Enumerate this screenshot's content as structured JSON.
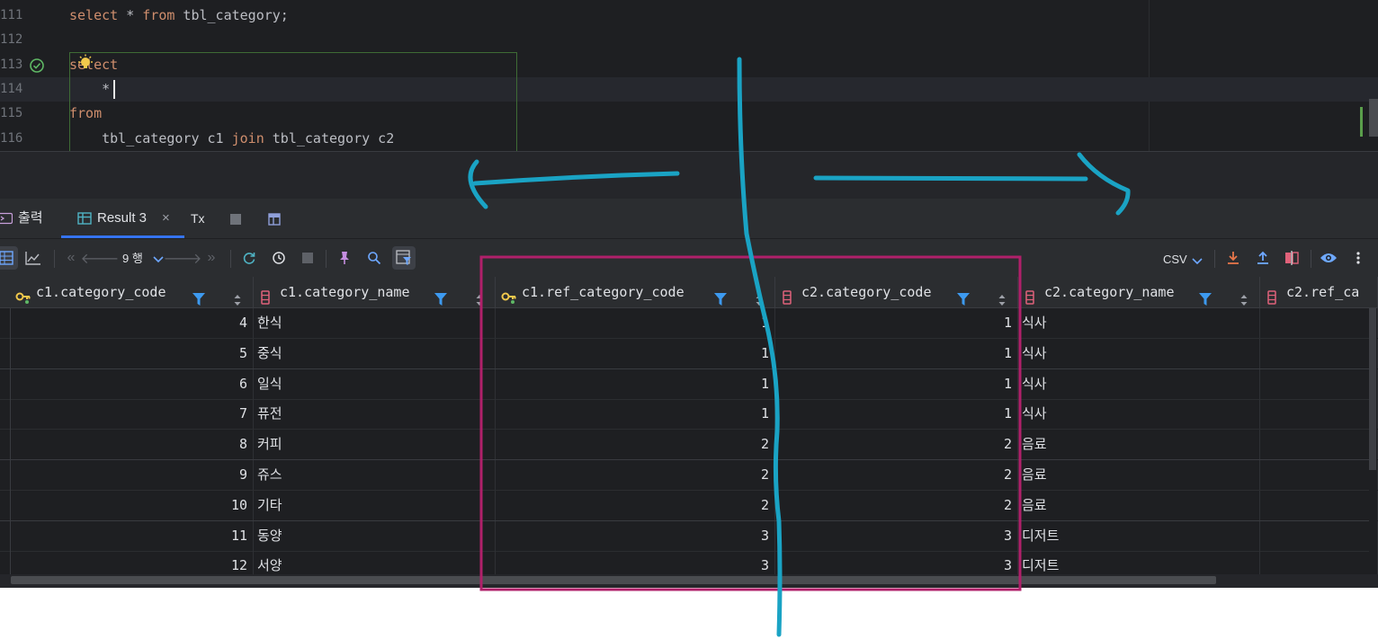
{
  "editor": {
    "lines": [
      {
        "number": "111",
        "tokens": [
          {
            "t": "select",
            "kw": true
          },
          {
            "t": " * ",
            "kw": false
          },
          {
            "t": "from",
            "kw": true
          },
          {
            "t": " tbl_category;",
            "kw": false
          }
        ]
      },
      {
        "number": "112",
        "tokens": []
      },
      {
        "number": "113",
        "tokens": [
          {
            "t": "select",
            "kw": true
          }
        ]
      },
      {
        "number": "114",
        "tokens": [
          {
            "t": "    *",
            "kw": false
          }
        ]
      },
      {
        "number": "115",
        "tokens": [
          {
            "t": "from",
            "kw": true
          }
        ]
      },
      {
        "number": "116",
        "tokens": [
          {
            "t": "    tbl_category c1 ",
            "kw": false
          },
          {
            "t": "join",
            "kw": true
          },
          {
            "t": " tbl_category c2",
            "kw": false
          }
        ]
      }
    ]
  },
  "results_panel": {
    "tabs": {
      "output_label": "출력",
      "result_label": "Result 3",
      "close_glyph": "×",
      "tx_label": "Tx"
    },
    "toolbar": {
      "row_count": "9 행",
      "export_format": "CSV"
    },
    "columns": [
      {
        "name": "c1.category_code",
        "icon": "key-column-icon"
      },
      {
        "name": "c1.category_name",
        "icon": "column-icon"
      },
      {
        "name": "c1.ref_category_code",
        "icon": "key-column-icon"
      },
      {
        "name": "c2.category_code",
        "icon": "column-icon"
      },
      {
        "name": "c2.category_name",
        "icon": "column-icon"
      },
      {
        "name": "c2.ref_ca",
        "icon": "column-icon"
      }
    ],
    "rows": [
      [
        "4",
        "한식",
        "1",
        "1",
        "식사",
        ""
      ],
      [
        "5",
        "중식",
        "1",
        "1",
        "식사",
        ""
      ],
      [
        "6",
        "일식",
        "1",
        "1",
        "식사",
        ""
      ],
      [
        "7",
        "퓨전",
        "1",
        "1",
        "식사",
        ""
      ],
      [
        "8",
        "커피",
        "2",
        "2",
        "음료",
        ""
      ],
      [
        "9",
        "쥬스",
        "2",
        "2",
        "음료",
        ""
      ],
      [
        "10",
        "기타",
        "2",
        "2",
        "음료",
        ""
      ],
      [
        "11",
        "동양",
        "3",
        "3",
        "디저트",
        ""
      ],
      [
        "12",
        "서양",
        "3",
        "3",
        "디저트",
        ""
      ]
    ]
  },
  "colors": {
    "accent": "#3574f0",
    "annotation_pen": "#1aa3c4",
    "highlight_box": "#b0206a"
  }
}
